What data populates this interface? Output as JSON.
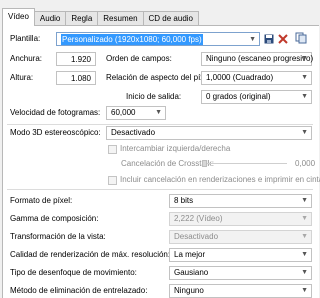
{
  "tabs": [
    "Vídeo",
    "Audio",
    "Regla",
    "Resumen",
    "CD de audio"
  ],
  "template": {
    "label": "Plantilla:",
    "value": "Personalizado (1920x1080; 60,000 fps)"
  },
  "width": {
    "label": "Anchura:",
    "value": "1.920"
  },
  "height": {
    "label": "Altura:",
    "value": "1.080"
  },
  "field_order": {
    "label": "Orden de campos:",
    "value": "Ninguno (escaneo progresivo)"
  },
  "pixel_aspect": {
    "label": "Relación de aspecto del píxel:",
    "value": "1,0000 (Cuadrado)"
  },
  "output_start": {
    "label": "Inicio de salida:",
    "value": "0 grados (original)"
  },
  "frame_rate": {
    "label": "Velocidad de fotogramas:",
    "value": "60,000"
  },
  "stereo_3d": {
    "label": "Modo 3D estereoscópico:",
    "value": "Desactivado"
  },
  "swap_lr": {
    "label": "Intercambiar izquierda/derecha",
    "checked": false
  },
  "crosstalk": {
    "label": "Cancelación de Crosstalk:",
    "value": "0,000"
  },
  "include_crosstalk": {
    "label": "Incluir cancelación en renderizaciones e imprimir en cinta",
    "checked": false
  },
  "pixel_format": {
    "label": "Formato de píxel:",
    "value": "8 bits"
  },
  "gamma": {
    "label": "Gamma de composición:",
    "value": "2,222 (Vídeo)"
  },
  "view_transform": {
    "label": "Transformación de la vista:",
    "value": "Desactivado"
  },
  "render_quality": {
    "label": "Calidad de renderización de máx. resolución:",
    "value": "La mejor"
  },
  "motion_blur": {
    "label": "Tipo de desenfoque de movimiento:",
    "value": "Gausiano"
  },
  "deinterlace": {
    "label": "Método de eliminación de entrelazado:",
    "value": "Ninguno"
  },
  "icons": {
    "save": "save-icon",
    "delete": "delete-icon",
    "copy": "copy-icon",
    "dropdown": "chevron-down-icon"
  },
  "colors": {
    "selection": "#3399ff",
    "delete_icon": "#c0392b",
    "save_icon": "#2b4a7a"
  }
}
